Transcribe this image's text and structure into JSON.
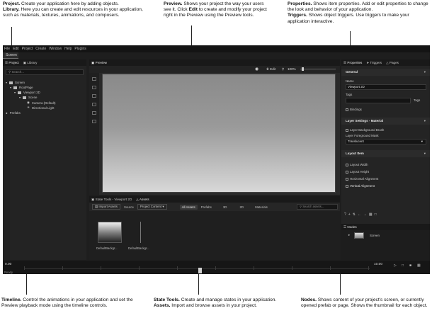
{
  "callouts": {
    "project_library": {
      "title1": "Project.",
      "text1": " Create your application here by adding objects.",
      "title2": "Library.",
      "text2": " Here you can create and edit resources in your application, such as materials, textures, animations, and composers."
    },
    "preview": {
      "title": "Preview.",
      "text": " Shows your project the way your users see it. Click ",
      "edit": "Edit",
      "text2": " to create and modify your project right in the Preview using the Preview tools."
    },
    "properties": {
      "title1": "Properties.",
      "text1": " Shows item properties. Add or edit properties to change the look and behavior of your application.",
      "title2": "Triggers.",
      "text2": " Shows object triggers. Use triggers to make your application interactive."
    },
    "timeline": {
      "title": "Timeline.",
      "text": " Control the animations in your application and set the Preview playback mode using the timeline controls."
    },
    "state_tools": {
      "title1": "State Tools.",
      "text1": " Create and manage states in your application.",
      "title2": "Assets.",
      "text2": " Import and browse assets in your project."
    },
    "nodes": {
      "title": "Nodes.",
      "text": " Shows content of your project's screen, or currently opened prefab or page. Shows the thumbnail for each object."
    }
  },
  "app": {
    "menu": [
      "File",
      "Edit",
      "Project",
      "Create",
      "Window",
      "Help",
      "Plugins"
    ],
    "screen_tab": "Screen",
    "left_tabs": [
      "Project",
      "Library"
    ],
    "search_placeholder": "Search...",
    "tree": [
      {
        "label": "Screen",
        "level": 0
      },
      {
        "label": "RootPage",
        "level": 1
      },
      {
        "label": "Viewport 2D",
        "level": 2
      },
      {
        "label": "Scene",
        "level": 3
      },
      {
        "label": "Camera (Default)",
        "level": 4
      },
      {
        "label": "Directional Light",
        "level": 4
      },
      {
        "label": "Prefabs",
        "level": 0
      }
    ],
    "preview_tab": "Preview",
    "edit_label": "Edit",
    "zoom": "100%",
    "state_tabs": [
      "State Tools - Viewport 2D",
      "Assets"
    ],
    "import_assets": "Import Assets",
    "source_label": "Source",
    "source_value": "Project Content",
    "asset_filters": [
      "All Assets",
      "Prefabs",
      "3D",
      "2D",
      "Materials"
    ],
    "asset_search_placeholder": "Search assets...",
    "assets": [
      "DefaultBackgr...",
      "DefaultBackgr..."
    ],
    "right_tabs": [
      "Properties",
      "Triggers",
      "Pages"
    ],
    "sections": {
      "general": "General",
      "name_label": "Name",
      "name_value": "Viewport 2D",
      "tags_label": "Tags",
      "tags_button": "Tags",
      "bindings": "Bindings",
      "layer_settings": "Layer Settings - Material",
      "layer_bg": "Layer Background Brush",
      "layer_fg": "Layer Foreground Mask",
      "layer_fg_value": "Translucent",
      "layout_item": "Layout Item",
      "layout_width": "Layout Width",
      "layout_height": "Layout Height",
      "horizontal_alignment": "Horizontal Alignment",
      "vertical_alignment": "Vertical Alignment"
    },
    "nodes_tab": "Nodes",
    "nodes_item": "Screen",
    "timeline_start": "0.00",
    "timeline_end": "10.00",
    "status": "Ready"
  }
}
